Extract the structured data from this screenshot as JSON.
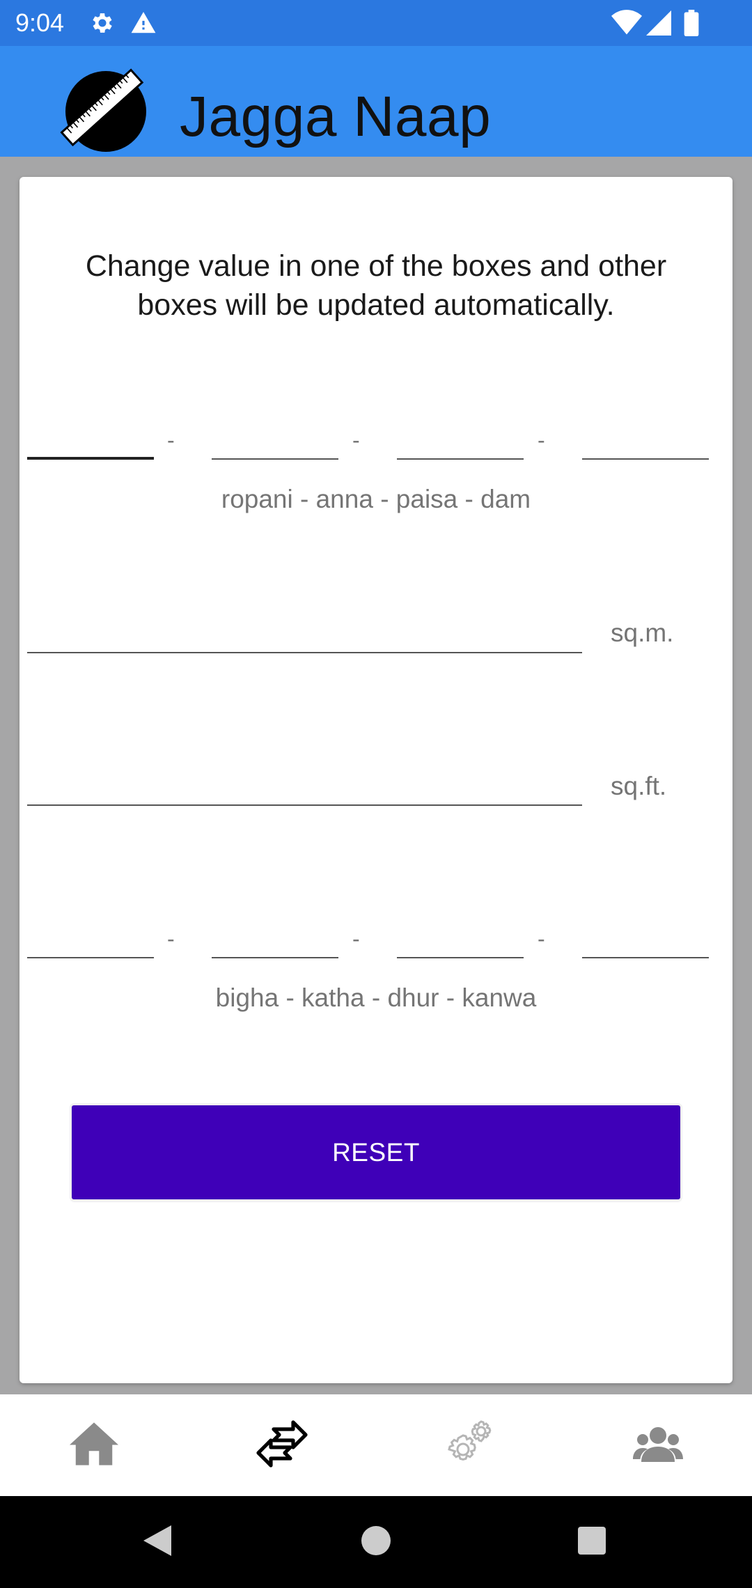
{
  "status_bar": {
    "time": "9:04",
    "icons": [
      "settings-icon",
      "warning-icon",
      "wifi-icon",
      "signal-icon",
      "battery-icon"
    ]
  },
  "app_bar": {
    "title": "Jagga Naap",
    "logo": "ruler-ball-logo"
  },
  "main": {
    "instruction": "Change value in one of the boxes and other boxes will be updated automatically.",
    "ropani_group": {
      "fields": [
        {
          "name": "ropani",
          "value": ""
        },
        {
          "name": "anna",
          "value": ""
        },
        {
          "name": "paisa",
          "value": ""
        },
        {
          "name": "dam",
          "value": ""
        }
      ],
      "separator": "-",
      "caption": "ropani - anna - paisa - dam"
    },
    "sqm": {
      "value": "",
      "unit": "sq.m."
    },
    "sqft": {
      "value": "",
      "unit": "sq.ft."
    },
    "bigha_group": {
      "fields": [
        {
          "name": "bigha",
          "value": ""
        },
        {
          "name": "katha",
          "value": ""
        },
        {
          "name": "dhur",
          "value": ""
        },
        {
          "name": "kanwa",
          "value": ""
        }
      ],
      "separator": "-",
      "caption": "bigha - katha - dhur - kanwa"
    },
    "reset_label": "RESET"
  },
  "bottom_nav": {
    "items": [
      {
        "icon": "home-icon",
        "active": false
      },
      {
        "icon": "convert-arrows-icon",
        "active": true
      },
      {
        "icon": "settings-gears-icon",
        "active": false
      },
      {
        "icon": "group-icon",
        "active": false
      }
    ]
  },
  "system_nav": [
    "back-icon",
    "home-circle-icon",
    "recents-icon"
  ],
  "colors": {
    "status_bar": "#2b78e0",
    "app_bar": "#348cf0",
    "reset_button": "#3f00b8",
    "background": "#a6a6a7"
  }
}
